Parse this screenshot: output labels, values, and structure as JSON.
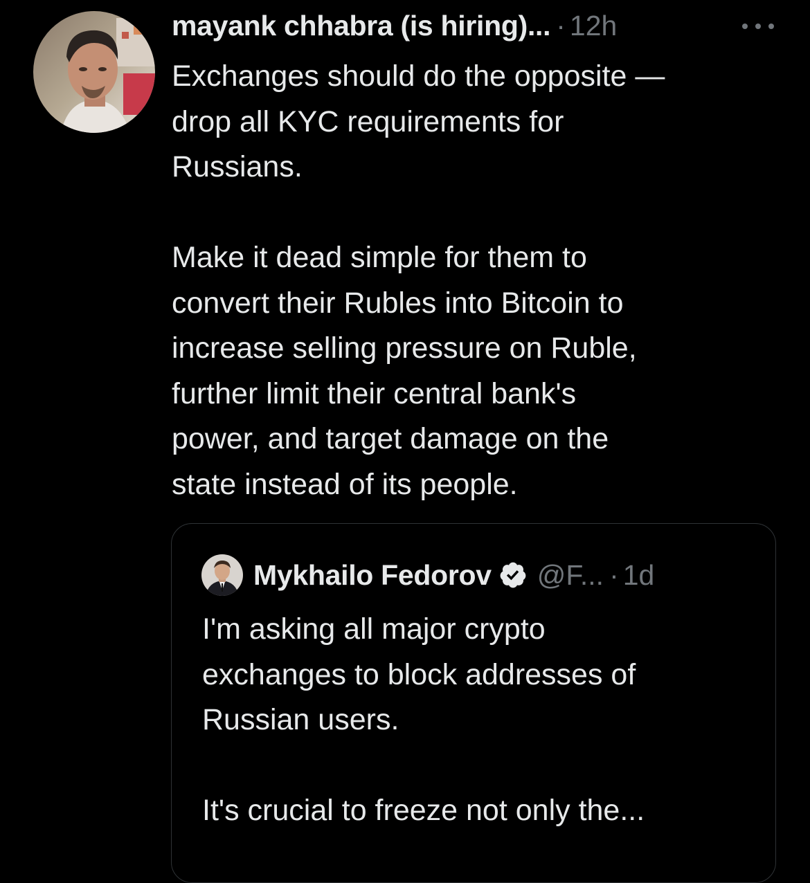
{
  "theme": {
    "background": "#000000",
    "text_primary": "#e7e9ea",
    "text_secondary": "#71767b",
    "border": "#2f3336"
  },
  "tweet": {
    "author_name": "mayank chhabra (is hiring)...",
    "separator": "·",
    "time": "12h",
    "more_icon": "more-horizontal-icon",
    "body_lines_p1": [
      "Exchanges should do the opposite —",
      "drop all KYC requirements for",
      "Russians."
    ],
    "body_lines_p2": [
      "Make it dead simple for them to",
      "convert their Rubles into Bitcoin to",
      "increase selling pressure on Ruble,",
      "further limit their central bank's",
      "power, and target damage on the",
      "state instead of its people."
    ]
  },
  "quoted_tweet": {
    "author_name": "Mykhailo Fedorov",
    "verified_icon": "verified-badge-icon",
    "handle": "@F...",
    "separator": "·",
    "time": "1d",
    "body_lines_p1": [
      "I'm asking all major crypto",
      "exchanges to block addresses of",
      "Russian users."
    ],
    "body_lines_p2": [
      "It's crucial to freeze not only the..."
    ]
  }
}
